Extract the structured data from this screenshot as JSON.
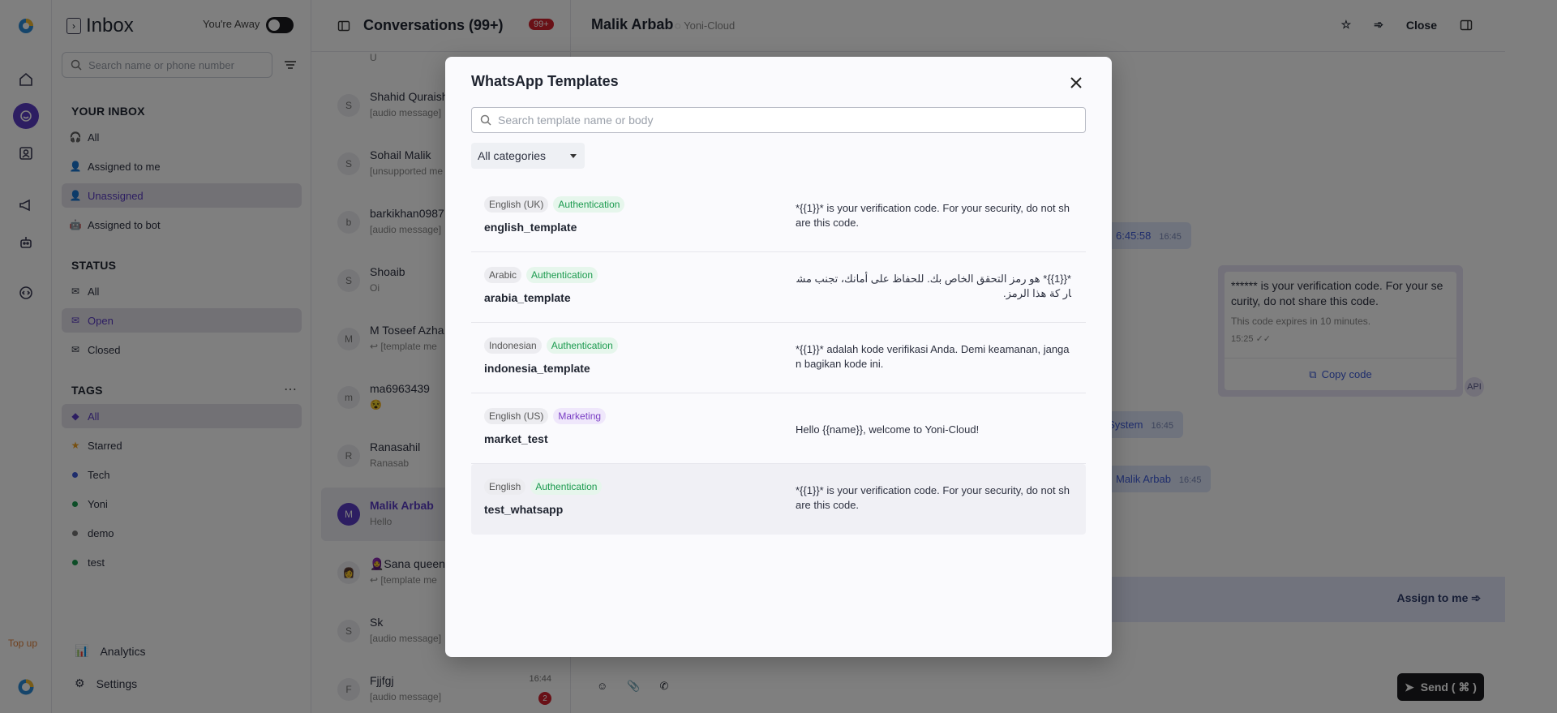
{
  "rail": {
    "top_up": "Top up"
  },
  "sidebar": {
    "title": "Inbox",
    "away_label": "You're Away",
    "search_placeholder": "Search name or phone number",
    "your_inbox_label": "YOUR INBOX",
    "inbox_items": [
      {
        "label": "All",
        "active": false
      },
      {
        "label": "Assigned to me",
        "active": false
      },
      {
        "label": "Unassigned",
        "active": true
      },
      {
        "label": "Assigned to bot",
        "active": false
      }
    ],
    "status_label": "STATUS",
    "status_items": [
      {
        "label": "All",
        "active": false
      },
      {
        "label": "Open",
        "active": true
      },
      {
        "label": "Closed",
        "active": false
      }
    ],
    "tags_label": "TAGS",
    "tag_items": [
      {
        "label": "All",
        "active": true
      },
      {
        "label": "Starred"
      },
      {
        "label": "Tech",
        "color": "#3d5bd9"
      },
      {
        "label": "Yoni",
        "color": "#1b9a4e"
      },
      {
        "label": "demo",
        "color": "#777777"
      },
      {
        "label": "test",
        "color": "#1b9a4e"
      }
    ],
    "analytics_label": "Analytics",
    "settings_label": "Settings"
  },
  "conversations": {
    "title": "Conversations (99+)",
    "unread_badge": "99+",
    "top_partial": "U",
    "items": [
      {
        "initial": "S",
        "name": "Shahid Quraish",
        "sub": "[audio message]"
      },
      {
        "initial": "S",
        "name": "Sohail Malik",
        "sub": "[unsupported me"
      },
      {
        "initial": "b",
        "name": "barkikhan0987",
        "sub": "[audio message]"
      },
      {
        "initial": "S",
        "name": "Shoaib",
        "sub": "Oi"
      },
      {
        "initial": "M",
        "name": "M Toseef Azha",
        "sub": "↩ [template me"
      },
      {
        "initial": "m",
        "name": "ma6963439",
        "sub": "😵"
      },
      {
        "initial": "R",
        "name": "Ranasahil",
        "sub": "Ranasab"
      },
      {
        "initial": "M",
        "name": "Malik Arbab",
        "sub": "Hello",
        "active": true
      },
      {
        "initial": "👩",
        "name": "🧕Sana queen",
        "sub": "↩ [template me"
      },
      {
        "initial": "S",
        "name": "Sk",
        "sub": "[audio message]"
      },
      {
        "initial": "F",
        "name": "Fjjfgj",
        "sub": "[audio message]",
        "time": "16:44",
        "count": "2"
      }
    ]
  },
  "chat": {
    "contact_name": "Malik Arbab",
    "source": "Yoni-Cloud",
    "close_label": "Close",
    "pill1_text": "6:45:58",
    "pill1_time": "16:45",
    "template_card": {
      "text": "****** is your verification code. For your se curity, do not share this code.",
      "expiry": "This code expires in 10 minutes.",
      "time": "15:25",
      "copy_label": "Copy code"
    },
    "api_badge": "API",
    "pill2_text": "y System",
    "pill2_time": "16:45",
    "pill3_text": "Malik Arbab",
    "pill3_time": "16:45",
    "assign_label": "Assign to me",
    "send_label": "Send ( ⌘ )"
  },
  "modal": {
    "title": "WhatsApp Templates",
    "search_placeholder": "Search template name or body",
    "category_value": "All categories",
    "templates": [
      {
        "lang": "English (UK)",
        "category": "Authentication",
        "name": "english_template",
        "body": "*{{1}}* is your verification code. For your security, do not sh are this code."
      },
      {
        "lang": "Arabic",
        "category": "Authentication",
        "name": "arabia_template",
        "body": "*{{1}}* هو رمز التحقق الخاص بك. للحفاظ على أمانك، تجنب مشار كة هذا الرمز."
      },
      {
        "lang": "Indonesian",
        "category": "Authentication",
        "name": "indonesia_template",
        "body": "*{{1}}* adalah kode verifikasi Anda. Demi keamanan, janga n bagikan kode ini."
      },
      {
        "lang": "English (US)",
        "category": "Marketing",
        "name": "market_test",
        "body": "Hello {{name}}, welcome to Yoni-Cloud!"
      },
      {
        "lang": "English",
        "category": "Authentication",
        "name": "test_whatsapp",
        "body": "*{{1}}* is your verification code. For your security, do not sh are this code."
      }
    ]
  }
}
